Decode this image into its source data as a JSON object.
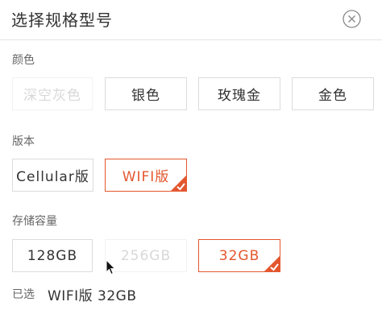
{
  "header": {
    "title": "选择规格型号",
    "close_icon": "close-circle-icon"
  },
  "sections": {
    "color": {
      "label": "颜色",
      "options": [
        {
          "label": "深空灰色",
          "state": "disabled"
        },
        {
          "label": "银色",
          "state": "normal"
        },
        {
          "label": "玫瑰金",
          "state": "normal"
        },
        {
          "label": "金色",
          "state": "normal"
        }
      ]
    },
    "version": {
      "label": "版本",
      "options": [
        {
          "label": "Cellular版",
          "state": "normal"
        },
        {
          "label": "WIFI版",
          "state": "selected"
        }
      ]
    },
    "storage": {
      "label": "存储容量",
      "options": [
        {
          "label": "128GB",
          "state": "normal"
        },
        {
          "label": "256GB",
          "state": "disabled"
        },
        {
          "label": "32GB",
          "state": "selected"
        }
      ]
    }
  },
  "selected": {
    "label": "已选",
    "value": "WIFI版 32GB"
  },
  "colors": {
    "accent": "#e4572e",
    "border": "#dcdcdc",
    "disabled_text": "#d8d8d8"
  }
}
